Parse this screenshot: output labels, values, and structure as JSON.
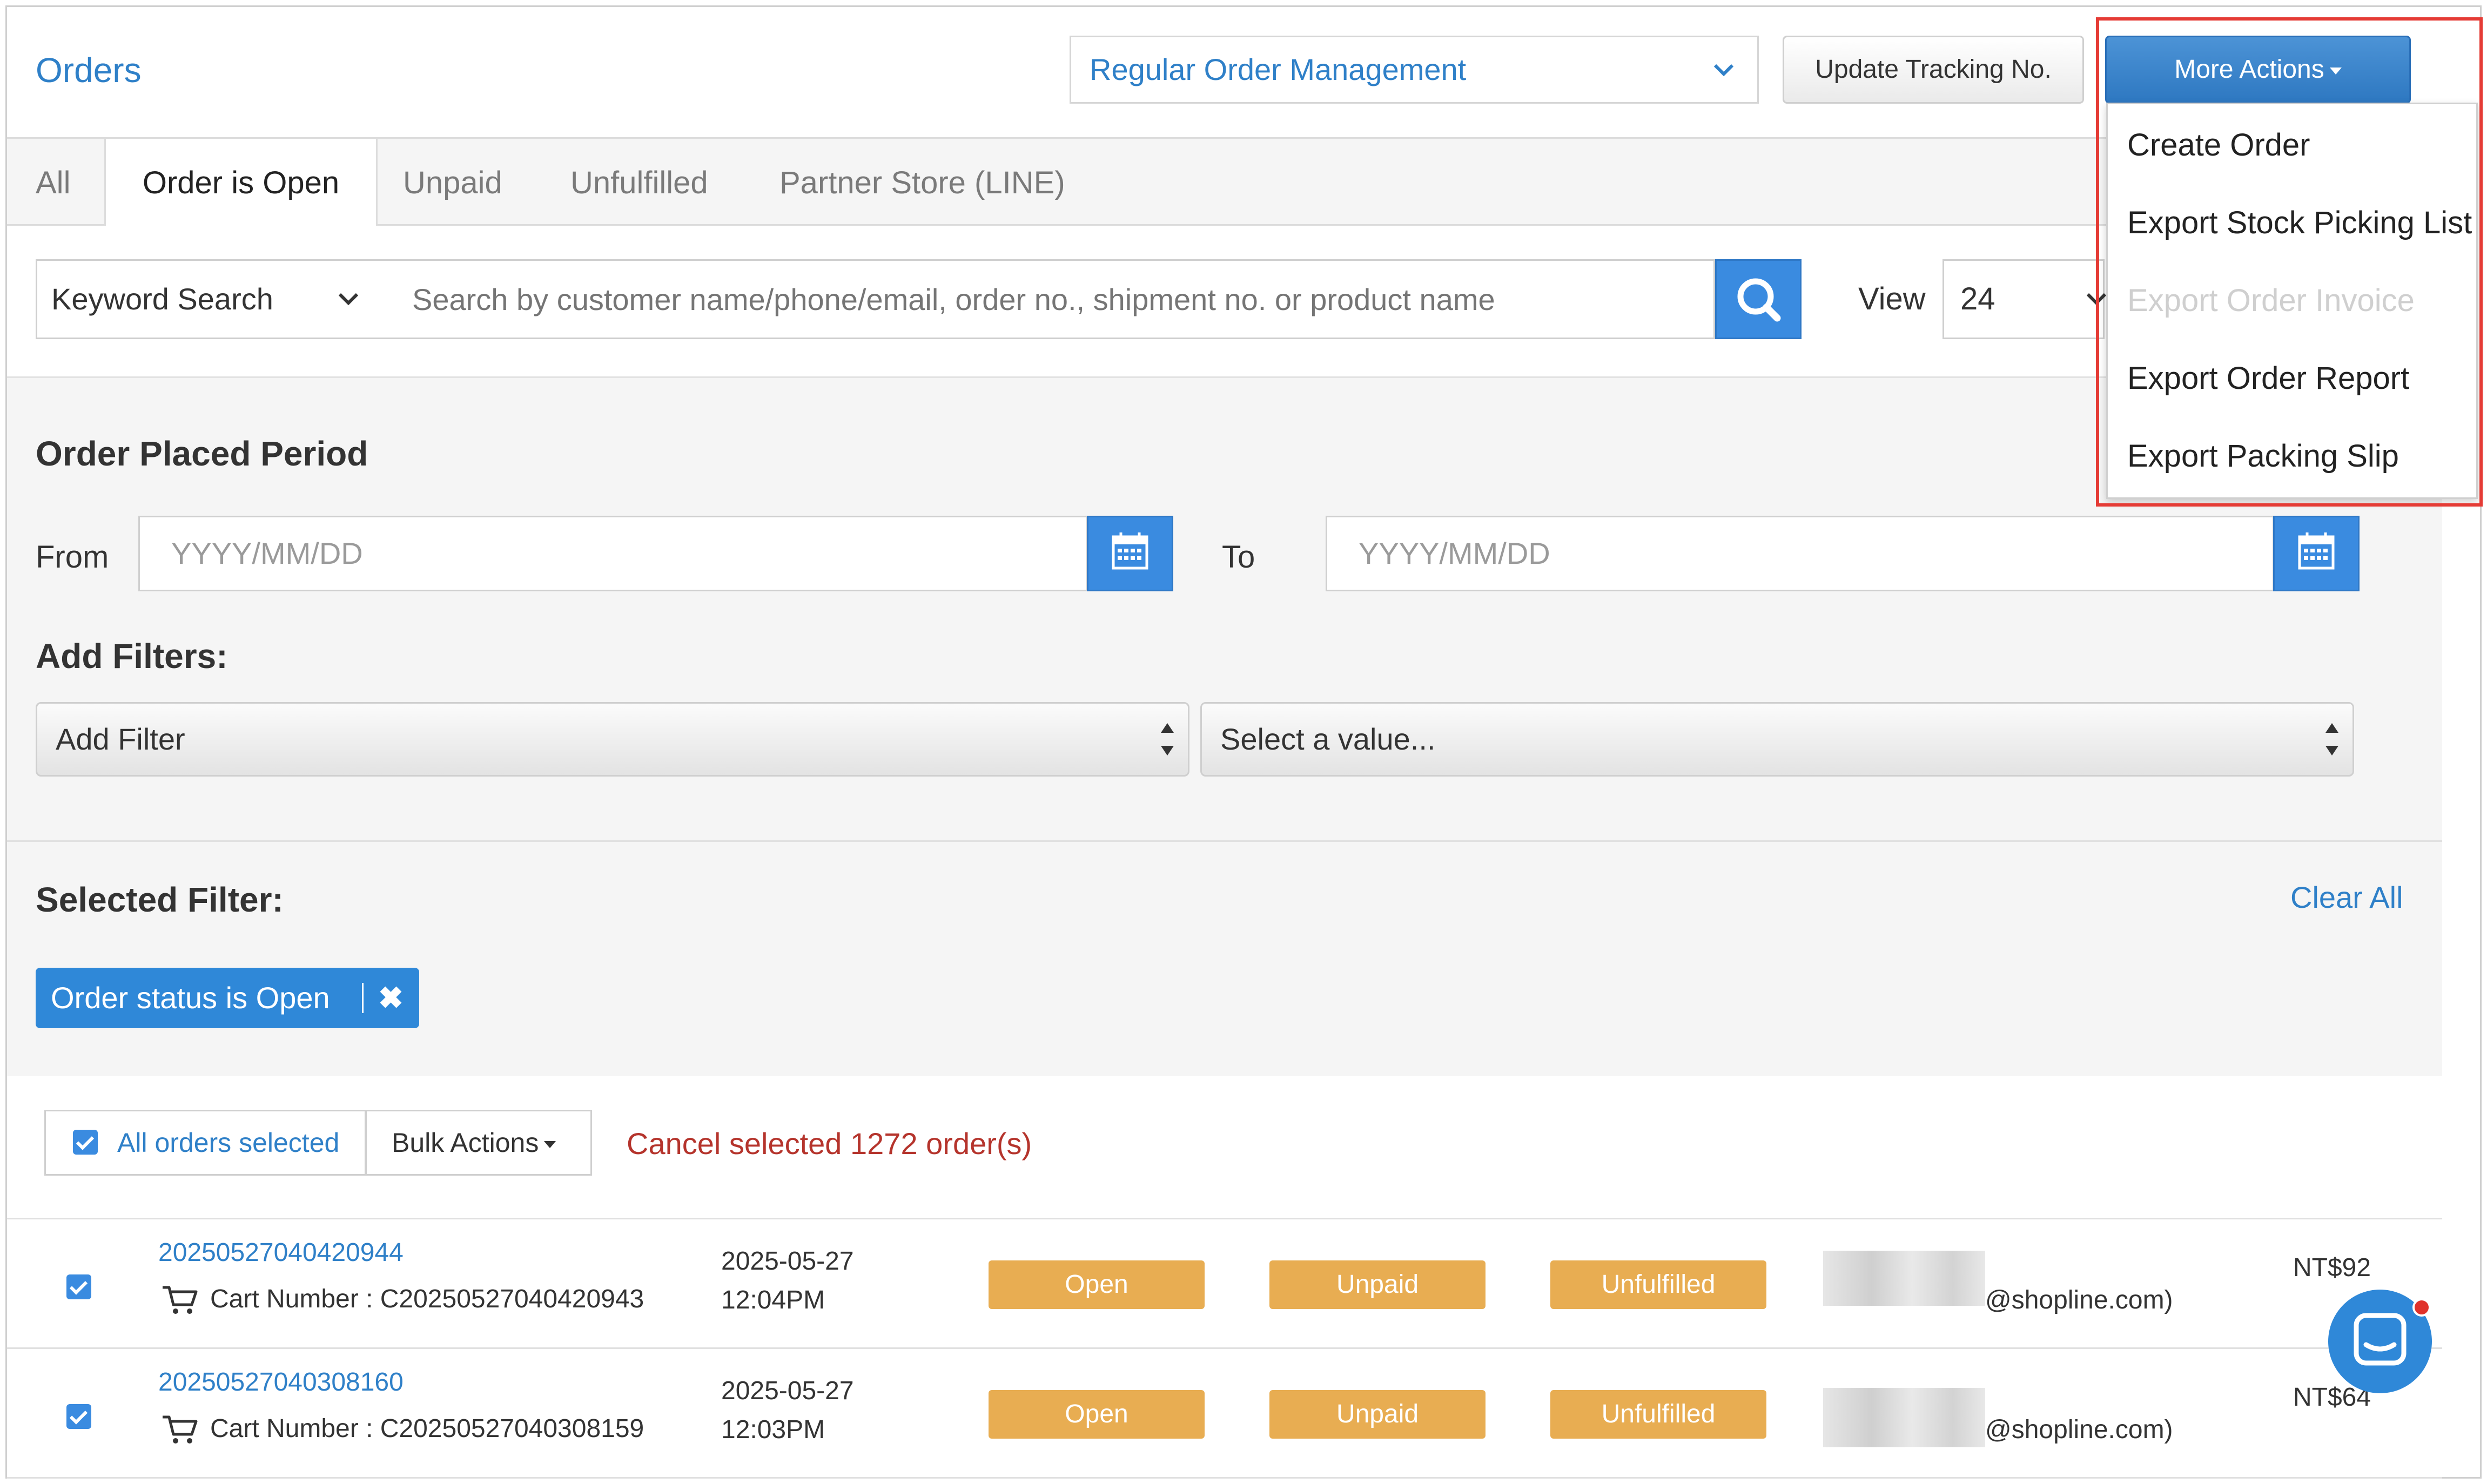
{
  "header": {
    "title": "Orders",
    "order_mgmt_select": "Regular Order Management",
    "update_tracking": "Update Tracking No.",
    "more_actions": "More Actions"
  },
  "tabs": [
    {
      "label": "All"
    },
    {
      "label": "Order is Open",
      "active": true
    },
    {
      "label": "Unpaid"
    },
    {
      "label": "Unfulfilled"
    },
    {
      "label": "Partner Store (LINE)"
    }
  ],
  "search": {
    "keyword_type": "Keyword Search",
    "placeholder": "Search by customer name/phone/email, order no., shipment no. or product name",
    "view_label": "View",
    "view_value": "24"
  },
  "period": {
    "title": "Order Placed Period",
    "from_label": "From",
    "to_label": "To",
    "date_placeholder": "YYYY/MM/DD"
  },
  "filters": {
    "title": "Add Filters:",
    "add_filter": "Add Filter",
    "select_value": "Select a value..."
  },
  "selected_filter": {
    "title": "Selected Filter:",
    "clear_all": "Clear All",
    "tag": "Order status is Open"
  },
  "bulk": {
    "all_selected": "All orders selected",
    "bulk_actions": "Bulk Actions",
    "cancel_selected": "Cancel selected 1272 order(s)"
  },
  "orders": [
    {
      "order_no": "20250527040420944",
      "cart": "Cart Number : C20250527040420943",
      "date": "2025-05-27",
      "time": "12:04PM",
      "status": "Open",
      "payment": "Unpaid",
      "fulfillment": "Unfulfilled",
      "email": "@shopline.com)",
      "total": "NT$92"
    },
    {
      "order_no": "20250527040308160",
      "cart": "Cart Number : C20250527040308159",
      "date": "2025-05-27",
      "time": "12:03PM",
      "status": "Open",
      "payment": "Unpaid",
      "fulfillment": "Unfulfilled",
      "email": "@shopline.com)",
      "total": "NT$64"
    }
  ],
  "more_actions_menu": [
    {
      "label": "Create Order",
      "disabled": false
    },
    {
      "label": "Export Stock Picking List",
      "disabled": false
    },
    {
      "label": "Export Order Invoice",
      "disabled": true
    },
    {
      "label": "Export Order Report",
      "disabled": false
    },
    {
      "label": "Export Packing Slip",
      "disabled": false
    }
  ],
  "icons": {
    "search": "search-icon",
    "calendar": "calendar-icon",
    "cart": "cart-icon",
    "chat": "chat-icon",
    "chevron": "chevron-down-icon"
  },
  "colors": {
    "accent": "#2f80c8",
    "badge": "#e8ad52",
    "danger": "#b5342c",
    "highlight": "#e53b35"
  }
}
